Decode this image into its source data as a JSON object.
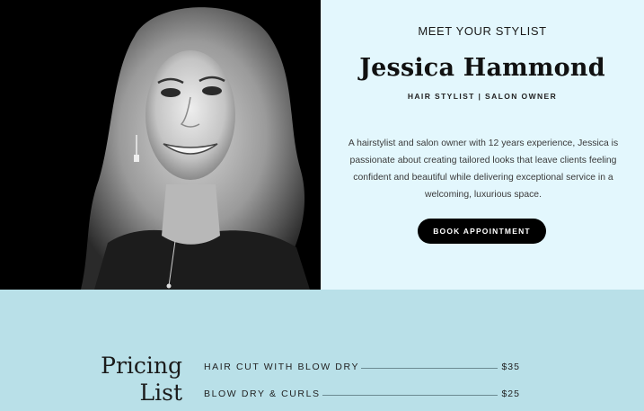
{
  "stylist": {
    "eyebrow": "MEET YOUR STYLIST",
    "name": "Jessica Hammond",
    "role": "HAIR STYLIST | SALON OWNER",
    "bio": "A hairstylist and salon owner with 12 years experience, Jessica is passionate about creating tailored looks that leave clients feeling confident and beautiful while delivering exceptional service in a welcoming, luxurious space.",
    "cta": "BOOK APPOINTMENT"
  },
  "pricing": {
    "title_line1": "Pricing",
    "title_line2": "List",
    "items": [
      {
        "service": "HAIR CUT WITH BLOW DRY",
        "price": "$35"
      },
      {
        "service": "BLOW DRY & CURLS",
        "price": "$25"
      }
    ]
  },
  "colors": {
    "hero_panel": "#e3f7fd",
    "pricing_bg": "#b9e0e8",
    "button_bg": "#000000",
    "photo_bg": "#000000"
  }
}
